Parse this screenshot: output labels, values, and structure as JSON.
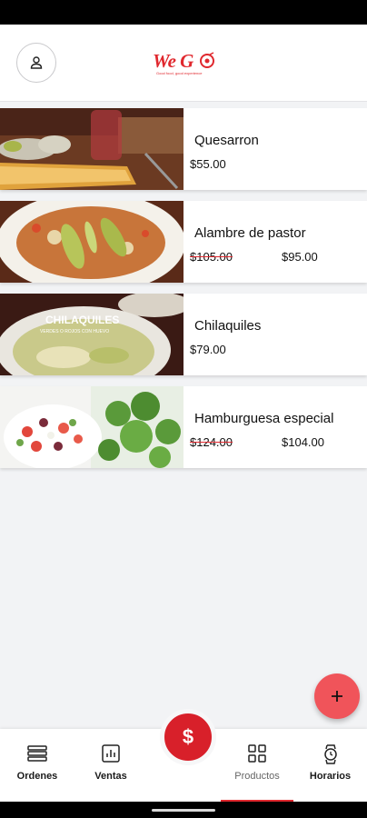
{
  "header": {
    "logo_text": "We G",
    "logo_tagline": "Good food, good experience"
  },
  "products": [
    {
      "name": "Quesarron",
      "price": "$55.00"
    },
    {
      "name": "Alambre de pastor",
      "old_price": "$105.00",
      "price": "$95.00"
    },
    {
      "name": "Chilaquiles",
      "price": "$79.00",
      "image_caption": "CHILAQUILES",
      "image_subcaption": "VERDES O ROJOS CON HUEVO"
    },
    {
      "name": "Hamburguesa especial",
      "old_price": "$124.00",
      "price": "$104.00"
    }
  ],
  "fab_add_label": "+",
  "fab_money_label": "$",
  "nav": {
    "ordenes": "Ordenes",
    "ventas": "Ventas",
    "productos": "Productos",
    "horarios": "Horarios"
  },
  "colors": {
    "brand_red": "#e0282e",
    "fab_add": "#f0545a",
    "fab_money": "#d8202a"
  }
}
